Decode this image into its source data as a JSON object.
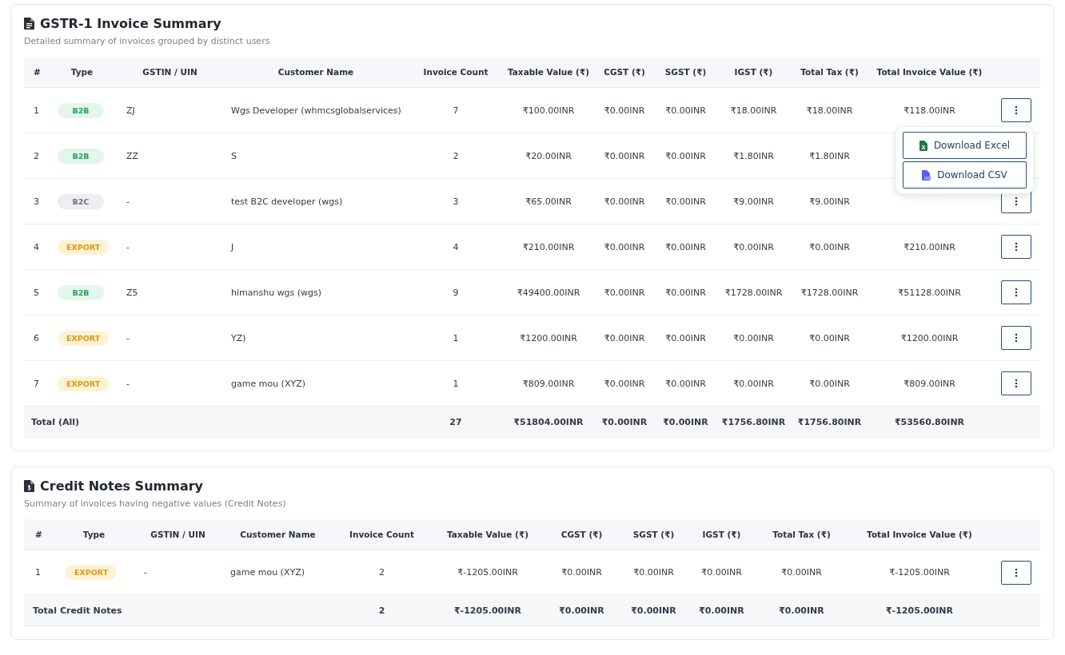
{
  "sections": [
    {
      "kind": "invoices",
      "title": "GSTR-1 Invoice Summary",
      "subtitle": "Detailed summary of invoices grouped by distinct users",
      "columns": [
        "#",
        "Type",
        "GSTIN / UIN",
        "Customer Name",
        "Invoice Count",
        "Taxable Value (₹)",
        "CGST (₹)",
        "SGST (₹)",
        "IGST (₹)",
        "Total Tax (₹)",
        "Total Invoice Value (₹)"
      ],
      "rows": [
        {
          "number": "1",
          "type": {
            "label": "B2B",
            "kind": "b2b"
          },
          "gstin": "ZJ",
          "customer": "Wgs Developer (whmcsglobalservices)",
          "count": "7",
          "taxable": "₹100.00INR",
          "cgst": "₹0.00INR",
          "sgst": "₹0.00INR",
          "igst": "₹18.00INR",
          "total_tax": "₹18.00INR",
          "total_value": "₹118.00INR",
          "menu": {
            "items": [
              {
                "label": "Download Excel",
                "kind": "excel"
              },
              {
                "label": "Download CSV",
                "kind": "csv"
              }
            ]
          }
        },
        {
          "number": "2",
          "type": {
            "label": "B2B",
            "kind": "b2b"
          },
          "gstin": "ZZ",
          "customer": "S",
          "count": "2",
          "taxable": "₹20.00INR",
          "cgst": "₹0.00INR",
          "sgst": "₹0.00INR",
          "igst": "₹1.80INR",
          "total_tax": "₹1.80INR"
        },
        {
          "number": "3",
          "type": {
            "label": "B2C",
            "kind": "b2c"
          },
          "gstin": "-",
          "customer": "test B2C developer (wgs)",
          "count": "3",
          "taxable": "₹65.00INR",
          "cgst": "₹0.00INR",
          "sgst": "₹0.00INR",
          "igst": "₹9.00INR",
          "total_tax": "₹9.00INR"
        },
        {
          "number": "4",
          "type": {
            "label": "EXPORT",
            "kind": "export"
          },
          "gstin": "-",
          "customer": "J",
          "count": "4",
          "taxable": "₹210.00INR",
          "cgst": "₹0.00INR",
          "sgst": "₹0.00INR",
          "igst": "₹0.00INR",
          "total_tax": "₹0.00INR",
          "total_value": "₹210.00INR"
        },
        {
          "number": "5",
          "type": {
            "label": "B2B",
            "kind": "b2b"
          },
          "gstin": "Z5",
          "customer": "himanshu wgs (wgs)",
          "count": "9",
          "taxable": "₹49400.00INR",
          "cgst": "₹0.00INR",
          "sgst": "₹0.00INR",
          "igst": "₹1728.00INR",
          "total_tax": "₹1728.00INR",
          "total_value": "₹51128.00INR"
        },
        {
          "number": "6",
          "type": {
            "label": "EXPORT",
            "kind": "export"
          },
          "gstin": "-",
          "customer": "YZ)",
          "count": "1",
          "taxable": "₹1200.00INR",
          "cgst": "₹0.00INR",
          "sgst": "₹0.00INR",
          "igst": "₹0.00INR",
          "total_tax": "₹0.00INR",
          "total_value": "₹1200.00INR"
        },
        {
          "number": "7",
          "type": {
            "label": "EXPORT",
            "kind": "export"
          },
          "gstin": "-",
          "customer": "game mou (XYZ)",
          "count": "1",
          "taxable": "₹809.00INR",
          "cgst": "₹0.00INR",
          "sgst": "₹0.00INR",
          "igst": "₹0.00INR",
          "total_tax": "₹0.00INR",
          "total_value": "₹809.00INR"
        }
      ],
      "total": {
        "label": "Total (All)",
        "count": "27",
        "taxable": "₹51804.00INR",
        "cgst": "₹0.00INR",
        "sgst": "₹0.00INR",
        "igst": "₹1756.80INR",
        "total_tax": "₹1756.80INR",
        "total_value": "₹53560.80INR"
      }
    },
    {
      "kind": "credit_notes",
      "title": "Credit Notes Summary",
      "subtitle": "Summary of invoices having negative values (Credit Notes)",
      "columns": [
        "#",
        "Type",
        "GSTIN / UIN",
        "Customer Name",
        "Invoice Count",
        "Taxable Value (₹)",
        "CGST (₹)",
        "SGST (₹)",
        "IGST (₹)",
        "Total Tax (₹)",
        "Total Invoice Value (₹)"
      ],
      "rows": [
        {
          "number": "1",
          "type": {
            "label": "EXPORT",
            "kind": "export"
          },
          "gstin": "-",
          "customer": "game mou (XYZ)",
          "count": "2",
          "taxable": "₹-1205.00INR",
          "cgst": "₹0.00INR",
          "sgst": "₹0.00INR",
          "igst": "₹0.00INR",
          "total_tax": "₹0.00INR",
          "total_value": "₹-1205.00INR"
        }
      ],
      "total": {
        "label": "Total Credit Notes",
        "count": "2",
        "taxable": "₹-1205.00INR",
        "cgst": "₹0.00INR",
        "sgst": "₹0.00INR",
        "igst": "₹0.00INR",
        "total_tax": "₹0.00INR",
        "total_value": "₹-1205.00INR"
      }
    }
  ]
}
